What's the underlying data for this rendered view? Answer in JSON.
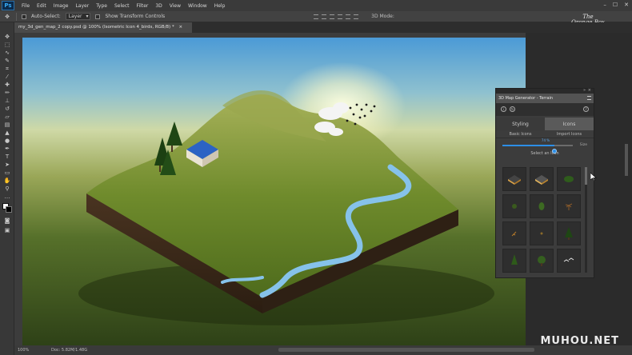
{
  "app": {
    "logo": "Ps",
    "brand_line1": "The",
    "brand_line2": "Orange Box"
  },
  "menu": [
    "File",
    "Edit",
    "Image",
    "Layer",
    "Type",
    "Select",
    "Filter",
    "3D",
    "View",
    "Window",
    "Help"
  ],
  "window_controls": [
    "–",
    "☐",
    "✕"
  ],
  "options_bar": {
    "auto_select_label": "Auto-Select:",
    "auto_select_value": "Layer",
    "show_transform_label": "Show Transform Controls",
    "mode_3d_label": "3D Mode:"
  },
  "document": {
    "tab_title": "my_3d_gen_map_2 copy.psd @ 100% (Isometric Icon 4_birds, RGB/8) *"
  },
  "status": {
    "zoom": "100%",
    "doc_size": "Doc: 5.82M/1.48G"
  },
  "watermark": "MUHOU.NET",
  "panel": {
    "title": "3D Map Generator - Terrain",
    "tabs": {
      "styling": "Styling",
      "icons": "Icons"
    },
    "subtabs": {
      "basic": "Basic Icons",
      "import": "Import Icons"
    },
    "size": {
      "label": "Size",
      "value_text": "74 %",
      "fraction": 0.74
    },
    "select_label": "Select an Icon",
    "icon_cells": [
      "house-a",
      "house-b",
      "bush",
      "small-plant",
      "shrub",
      "palm",
      "twig",
      "sprig",
      "pine-tree",
      "tall-tree",
      "round-tree",
      "birds"
    ]
  },
  "colors": {
    "accent": "#2d8ee6",
    "panel_bg": "#3c3c3c",
    "chrome": "#3a3a3a"
  }
}
